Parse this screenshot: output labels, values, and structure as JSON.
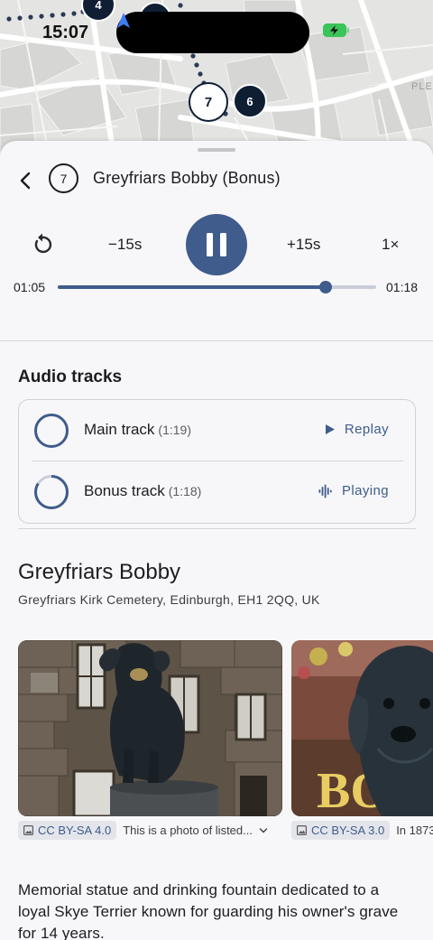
{
  "status_bar": {
    "time": "15:07"
  },
  "map": {
    "label": "PLEA",
    "stops": [
      "4",
      "7",
      "6"
    ]
  },
  "header": {
    "stop_number": "7",
    "title": "Greyfriars Bobby (Bonus)"
  },
  "player": {
    "skip_back_label": "−15s",
    "skip_forward_label": "+15s",
    "speed_label": "1×",
    "elapsed": "01:05",
    "total": "01:18",
    "progress": 0.84
  },
  "audio_tracks": {
    "title": "Audio tracks",
    "items": [
      {
        "name": "Main track",
        "duration": "(1:19)",
        "action": "Replay"
      },
      {
        "name": "Bonus track",
        "duration": "(1:18)",
        "action": "Playing"
      }
    ]
  },
  "place": {
    "title": "Greyfriars Bobby",
    "address": "Greyfriars Kirk Cemetery, Edinburgh, EH1 2QQ, UK"
  },
  "photos": [
    {
      "license": "CC BY-SA 4.0",
      "caption": "This is a photo of listed..."
    },
    {
      "license": "CC BY-SA 3.0",
      "caption": "In 1873"
    }
  ],
  "description": "Memorial statue and drinking fountain dedicated to a loyal Skye Terrier known for guarding his owner's grave for 14 years.",
  "colors": {
    "accent": "#3f5c8c",
    "map_marker": "#0f1e33",
    "sheet_background": "#f7f7f9"
  }
}
